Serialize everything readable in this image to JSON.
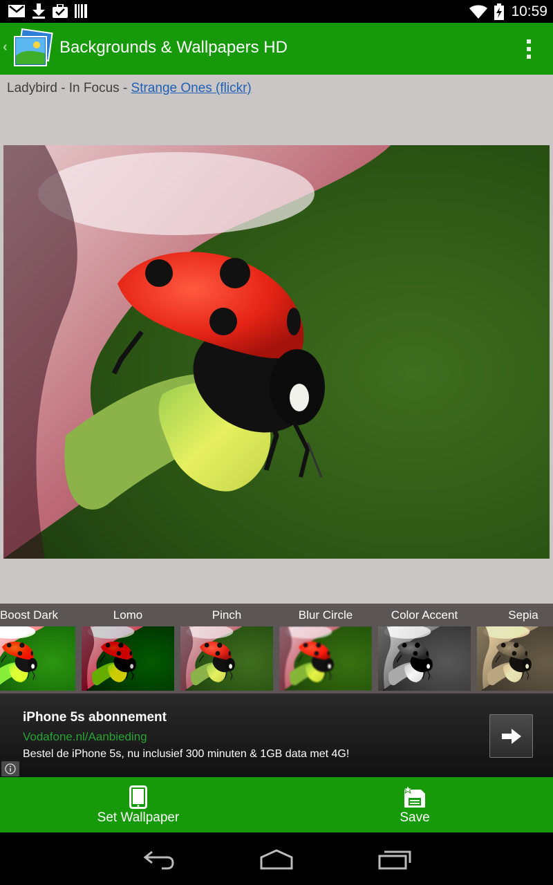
{
  "status_bar": {
    "time": "10:59",
    "icons": [
      "gmail-icon",
      "download-icon",
      "briefcase-icon",
      "barcode-icon",
      "wifi-icon",
      "battery-icon"
    ]
  },
  "app_bar": {
    "title": "Backgrounds & Wallpapers HD",
    "back_glyph": "‹",
    "color": "#169a09"
  },
  "photo_info": {
    "caption_prefix": "Ladybird - In Focus - ",
    "author_link": "Strange Ones (flickr)"
  },
  "filters": [
    {
      "label": "Boost Dark"
    },
    {
      "label": "Lomo"
    },
    {
      "label": "Pinch"
    },
    {
      "label": "Blur Circle"
    },
    {
      "label": "Color Accent"
    },
    {
      "label": "Sepia"
    }
  ],
  "ad": {
    "title": "iPhone 5s abonnement",
    "url": "Vodafone.nl/Aanbieding",
    "body": "Bestel de iPhone 5s, nu inclusief 300 minuten & 1GB data met 4G!",
    "info_glyph": "ⓘ"
  },
  "bottom_actions": {
    "set_wallpaper": "Set Wallpaper",
    "save": "Save"
  }
}
